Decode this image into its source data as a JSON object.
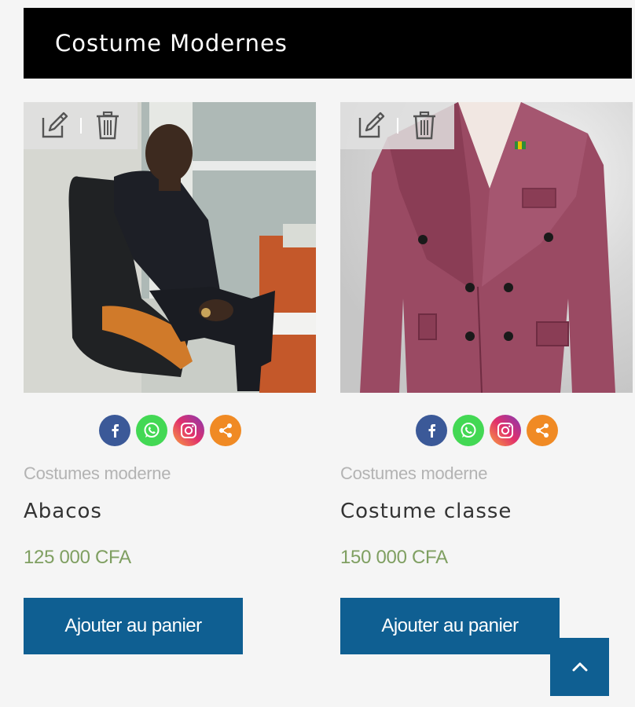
{
  "section": {
    "title": "Costume Modernes"
  },
  "colors": {
    "header_bg": "#000000",
    "button_bg": "#0f5f92",
    "price": "#7f9f61",
    "category": "#b3b3b3",
    "facebook": "#3b5998",
    "whatsapp": "#43d854",
    "instagram": "#c13584",
    "share": "#f08a24"
  },
  "icons": {
    "edit": "edit-icon",
    "delete": "trash-icon",
    "facebook": "facebook-icon",
    "whatsapp": "whatsapp-icon",
    "instagram": "instagram-icon",
    "share": "share-icon",
    "scroll_top": "chevron-up-icon"
  },
  "products": [
    {
      "category": "Costumes moderne",
      "name": "Abacos",
      "price": "125 000 CFA",
      "cart_label": "Ajouter au panier"
    },
    {
      "category": "Costumes moderne",
      "name": "Costume classe",
      "price": "150 000 CFA",
      "cart_label": "Ajouter au panier"
    }
  ]
}
